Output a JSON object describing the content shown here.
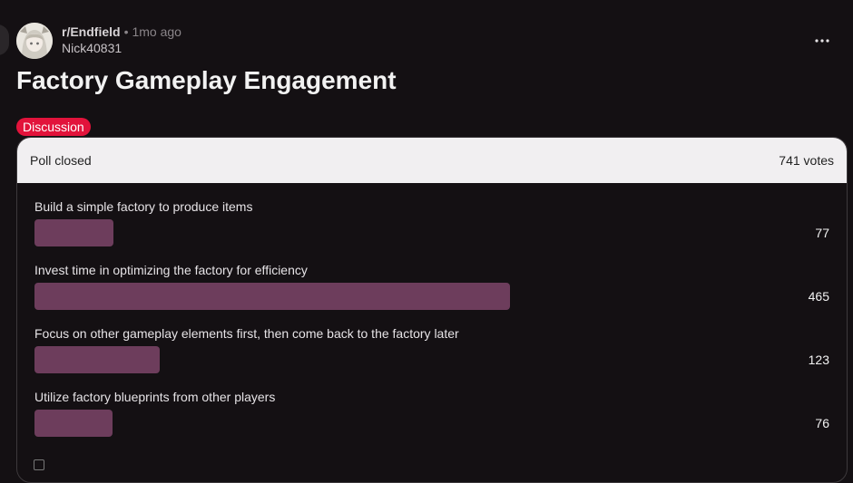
{
  "post": {
    "subreddit": "r/Endfield",
    "separator": "•",
    "time_ago": "1mo ago",
    "author": "Nick40831",
    "title": "Factory Gameplay Engagement",
    "flair": "Discussion"
  },
  "poll": {
    "status": "Poll closed",
    "total_votes": "741 votes",
    "options": [
      {
        "label": "Build a simple factory to produce items",
        "votes": "77",
        "share": 0.104
      },
      {
        "label": "Invest time in optimizing the factory for efficiency",
        "votes": "465",
        "share": 0.628
      },
      {
        "label": "Focus on other gameplay elements first, then come back to the factory later",
        "votes": "123",
        "share": 0.166
      },
      {
        "label": "Utilize factory blueprints from other players",
        "votes": "76",
        "share": 0.103
      }
    ]
  },
  "icons": {
    "avatar": "anime-character-avatar",
    "more": "more-options-icon"
  },
  "colors": {
    "background": "#141013",
    "flair": "#e2133b",
    "bar_fill": "#6d3d5c",
    "bar_track": "#2c262b",
    "poll_header": "#f1eff1"
  }
}
